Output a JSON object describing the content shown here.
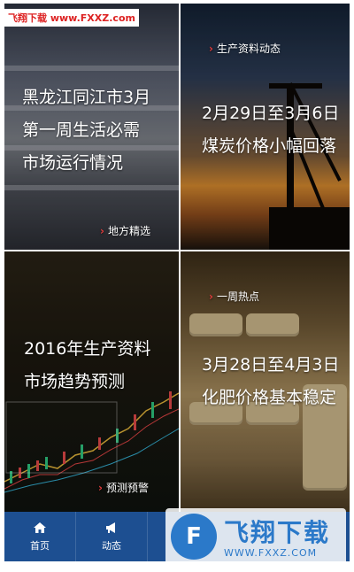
{
  "watermark_top": "飞翔下载 www.FXXZ.com",
  "tiles": [
    {
      "caption_lines": [
        "黑龙江同江市3月",
        "第一周生活必需",
        "市场运行情况"
      ],
      "tag": "地方精选"
    },
    {
      "caption_lines": [
        "2月29日至3月6日",
        "煤炭价格小幅回落"
      ],
      "tag": "生产资料动态"
    },
    {
      "caption_lines": [
        "2016年生产资料",
        "市场趋势预测"
      ],
      "tag": "预测预警"
    },
    {
      "caption_lines": [
        "3月28日至4月3日",
        "化肥价格基本稳定"
      ],
      "tag": "一周热点"
    }
  ],
  "tabs": [
    {
      "label": "首页",
      "icon": "home-icon"
    },
    {
      "label": "动态",
      "icon": "megaphone-icon"
    }
  ],
  "watermark": {
    "title": "飞翔下载",
    "url": "WWW.FXXZ.COM"
  },
  "colors": {
    "tab_bar": "#1d4f91",
    "tag_chevron": "#e43b3b"
  }
}
